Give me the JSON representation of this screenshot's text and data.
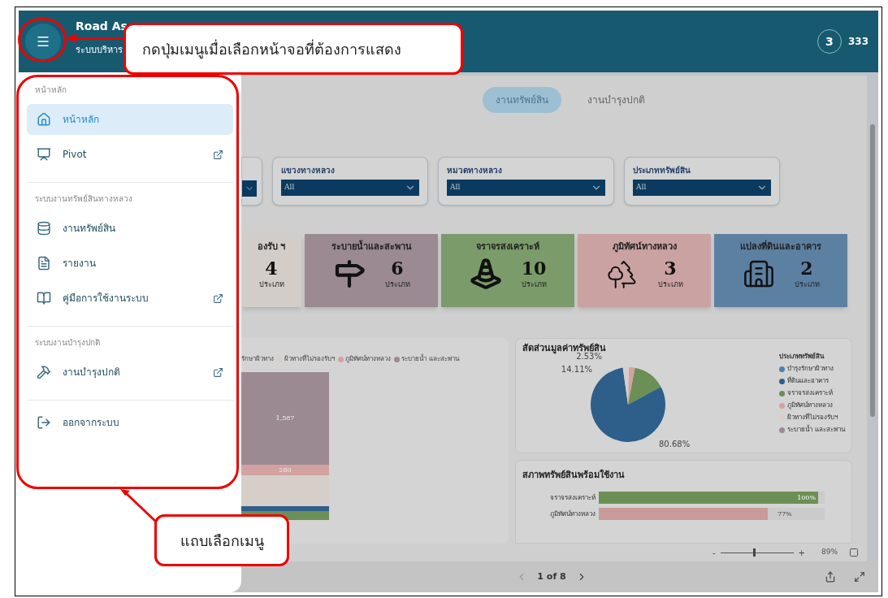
{
  "header": {
    "title": "Road As",
    "subtitle": "ระบบบริหาร",
    "notification_count": "3",
    "user": "333"
  },
  "menu_callout": {
    "text": "กดปุ่มเมนูเมื่อเลือกหน้าจอที่ต้องการแสดง"
  },
  "sidebar_callout": {
    "text": "แถบเลือกเมนู"
  },
  "sidebar": {
    "sections": [
      {
        "title": "หน้าหลัก",
        "items": [
          {
            "label": "หน้าหลัก",
            "kind": "home",
            "selected": true,
            "external": false
          },
          {
            "label": "Pivot",
            "kind": "presentation",
            "selected": false,
            "external": true
          }
        ]
      },
      {
        "title": "ระบบงานทรัพย์สินทางหลวง",
        "items": [
          {
            "label": "งานทรัพย์สิน",
            "kind": "database",
            "selected": false,
            "external": false
          },
          {
            "label": "รายงาน",
            "kind": "file",
            "selected": false,
            "external": false
          },
          {
            "label": "คู่มือการใช้งานระบบ",
            "kind": "book",
            "selected": false,
            "external": true
          }
        ]
      },
      {
        "title": "ระบบงานบำรุงปกติ",
        "items": [
          {
            "label": "งานบำรุงปกติ",
            "kind": "hammer",
            "selected": false,
            "external": true
          }
        ]
      }
    ],
    "logout": {
      "label": "ออกจากระบบ"
    }
  },
  "tabs": [
    {
      "label": "งานทรัพย์สิน",
      "selected": true
    },
    {
      "label": "งานบำรุงปกติ",
      "selected": false
    }
  ],
  "filters": [
    {
      "cropped": true
    },
    {
      "cropped": false,
      "label": "แขวงทางหลวง",
      "value": "All"
    },
    {
      "cropped": false,
      "label": "หมวดทางหลวง",
      "value": "All"
    },
    {
      "cropped": false,
      "label": "ประเภททรัพย์สิน",
      "value": "All"
    }
  ],
  "cards": [
    {
      "title": "องรับ ฯ",
      "count": "4",
      "unit": "ประเภท",
      "color": "#d3cdc9",
      "kind": "plain"
    },
    {
      "title": "ระบายน้ำและสะพาน",
      "count": "6",
      "unit": "ประเภท",
      "color": "#9b8a91",
      "kind": "road"
    },
    {
      "title": "จราจรสงเคราะห์",
      "count": "10",
      "unit": "ประเภท",
      "color": "#7b9b6b",
      "kind": "traffic"
    },
    {
      "title": "ภูมิทัศน์ทางหลวง",
      "count": "3",
      "unit": "ประเภท",
      "color": "#cba2a2",
      "kind": "landscape"
    },
    {
      "title": "แปลงที่ดินและอาคาร",
      "count": "2",
      "unit": "ประเภท",
      "color": "#5c80a2",
      "kind": "buildings"
    }
  ],
  "stacked_chart": {
    "legend": [
      {
        "label": "รักษาผิวทาง"
      },
      {
        "label": "ผิวทางที่ไม่รองรับฯ",
        "color": "#d6cfc9"
      },
      {
        "label": "ภูมิทัศน์ทางหลวง",
        "color": "#d4a1a1"
      },
      {
        "label": "ระบายน้ำ และสะพาน",
        "color": "#9b8a91"
      }
    ],
    "segments": [
      {
        "label": "1,587",
        "color": "#9b8a91"
      },
      {
        "label": "260",
        "color": "#d4a1a1"
      },
      {
        "color": "#d6cfc9"
      },
      {
        "color": "#2e5f8a"
      },
      {
        "color": "#6b8f55"
      }
    ]
  },
  "pie_chart": {
    "title": "สัดส่วนมูลค่าทรัพย์สิน",
    "legend_title": "ประเภททรัพย์สิน",
    "slice_labels": [
      "2.53%",
      "14.11%",
      "80.68%"
    ],
    "legend": [
      {
        "label": "บำรุงรักษาผิวทาง",
        "color": "#4f7fb0"
      },
      {
        "label": "ที่ดินและอาคาร",
        "color": "#2e5f8a"
      },
      {
        "label": "จราจรสงเคราะห์",
        "color": "#6b8f55"
      },
      {
        "label": "ภูมิทัศน์ทางหลวง",
        "color": "#d4a1a1"
      },
      {
        "label": "ผิวทางที่ไม่รองรับฯ",
        "color": "#d6cfc9"
      },
      {
        "label": "ระบายน้ำ และสะพาน",
        "color": "#9b8a91"
      }
    ]
  },
  "bar_chart": {
    "title": "สภาพทรัพย์สินพร้อมใช้งาน",
    "bars": [
      {
        "label": "จราจรสงเคราะห์",
        "reading": "100%",
        "level": 1,
        "color": "#6b8f55"
      },
      {
        "label": "ภูมิทัศน์ทางหลวง",
        "reading": "77%",
        "level": 0.77,
        "color": "#c99a9a"
      }
    ]
  },
  "zoom": {
    "minus": "-",
    "plus": "+",
    "level": 0.45,
    "reading": "89%"
  },
  "pager": {
    "text": "1 of 8"
  }
}
